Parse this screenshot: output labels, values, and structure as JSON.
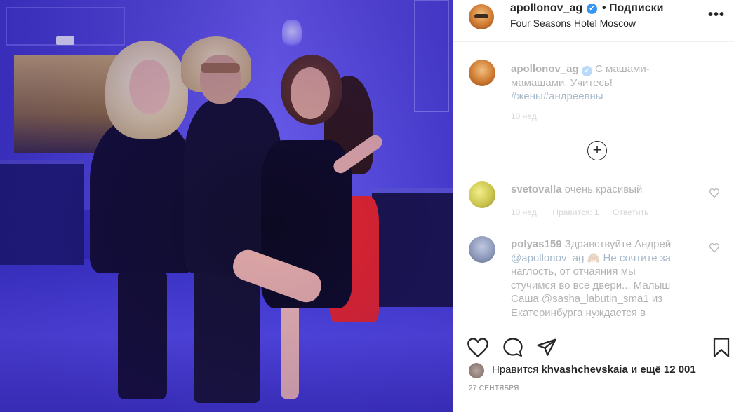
{
  "post": {
    "username": "apollonov_ag",
    "verified_mark": "✔",
    "follow_label": "• Подписки",
    "location": "Four Seasons Hotel Moscow",
    "more_label": "•••"
  },
  "caption": {
    "username": "apollonov_ag",
    "line1": "С машами-",
    "line2": "мамашами. Учитесь!",
    "line3": "#жены#андреевны",
    "time": "10 нед."
  },
  "load_more_label": "+",
  "comments": [
    {
      "username": "svetovalla",
      "text": "очень красивый",
      "time": "10 нед.",
      "likes": "Нравится: 1",
      "reply": "Ответить"
    },
    {
      "username": "polyas159",
      "lines": [
        "Здравствуйте Андрей",
        "@apollonov_ag 🙈 Не сочтите за",
        "наглость, от отчаяния мы",
        "стучимся во все двери... Малыш",
        "Саша @sasha_labutin_sma1 из",
        "Екатеринбурга нуждается в"
      ]
    }
  ],
  "likes": {
    "prefix": "Нравится",
    "user": "khvashchevskaia",
    "suffix": "и ещё 12 001"
  },
  "date": "27 СЕНТЯБРЯ",
  "icons": {
    "like": "heart-icon",
    "comment": "comment-icon",
    "share": "share-icon",
    "save": "bookmark-icon"
  },
  "colors": {
    "verified": "#3897f0",
    "text": "#262626",
    "muted": "#8e8e8e",
    "hashtag": "#00376b",
    "photo_tint": "#4a3fd8"
  }
}
